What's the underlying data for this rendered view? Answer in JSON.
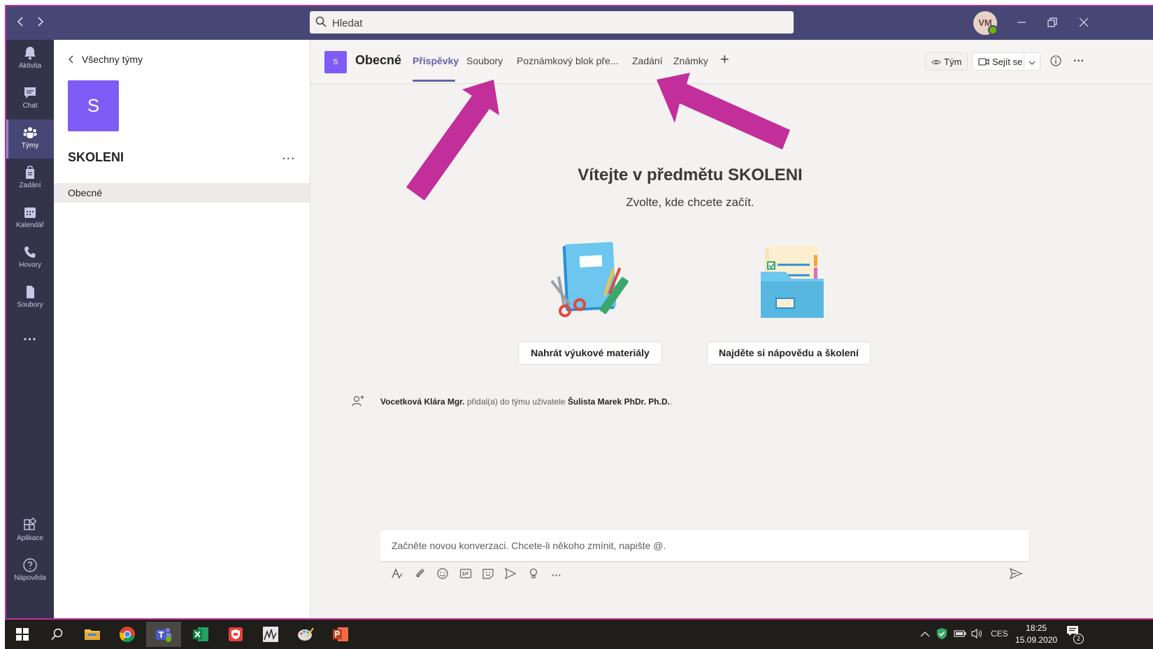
{
  "topbar": {
    "search_placeholder": "Hledat",
    "avatar_initials": "VM"
  },
  "rail": {
    "items": [
      {
        "label": "Aktivita",
        "icon": "bell-icon"
      },
      {
        "label": "Chat",
        "icon": "chat-icon"
      },
      {
        "label": "Týmy",
        "icon": "teams-icon",
        "active": true
      },
      {
        "label": "Zadání",
        "icon": "assignments-icon"
      },
      {
        "label": "Kalendář",
        "icon": "calendar-icon"
      },
      {
        "label": "Hovory",
        "icon": "phone-icon"
      },
      {
        "label": "Soubory",
        "icon": "file-icon"
      }
    ],
    "more": "...",
    "bottom": [
      {
        "label": "Aplikace",
        "icon": "apps-icon"
      },
      {
        "label": "Nápověda",
        "icon": "help-icon"
      }
    ]
  },
  "team_panel": {
    "back_label": "Všechny týmy",
    "team_initial": "S",
    "team_name": "SKOLENI",
    "more": "...",
    "channels": [
      "Obecné"
    ]
  },
  "channel_header": {
    "initial": "S",
    "title": "Obecné",
    "tabs": [
      "Příspěvky",
      "Soubory",
      "Poznámkový blok pře...",
      "Zadání",
      "Známky"
    ],
    "add_tab": "+",
    "team_button": "Tým",
    "meet_button": "Sejít se"
  },
  "welcome": {
    "title": "Vítejte v předmětu SKOLENI",
    "subtitle": "Zvolte, kde chcete začít.",
    "upload_button": "Nahrát výukové materiály",
    "help_button": "Najděte si nápovědu a školení"
  },
  "event": {
    "actor": "Vocetková Klára Mgr.",
    "action": " přidal(a) do týmu uživatele ",
    "target": "Šulista Marek PhDr. Ph.D.",
    "suffix": "."
  },
  "composer": {
    "placeholder": "Začněte novou konverzaci. Chcete-li někoho zmínit, napište @.",
    "more": "···"
  },
  "taskbar": {
    "lang": "CES",
    "time": "18:25",
    "date": "15.09.2020",
    "notifications": "2"
  },
  "colors": {
    "accent": "#6264a7",
    "topbar": "#464775",
    "rail": "#33344a",
    "team_tile": "#7f5cf5",
    "annotation_arrow": "#c22f9a"
  }
}
